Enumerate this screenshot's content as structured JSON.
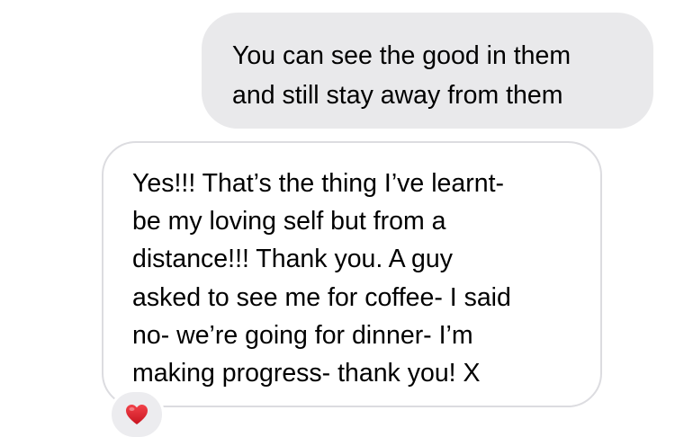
{
  "messages": {
    "sent": {
      "lines": [
        "You can see the good in them",
        "and still stay away from them"
      ]
    },
    "received": {
      "lines": [
        "Yes!!! That’s the thing I’ve learnt-",
        "be my loving self but from a",
        "distance!!! Thank you. A guy",
        "asked to see me for coffee- I said",
        "no- we’re going for dinner- I’m",
        "making progress- thank you! X"
      ],
      "reaction": {
        "icon": "heart-icon",
        "color": "#e8232d"
      }
    }
  },
  "colors": {
    "sent_bubble": "#e9e9eb",
    "received_border": "#dcdce0",
    "reaction_background": "#ececef"
  }
}
